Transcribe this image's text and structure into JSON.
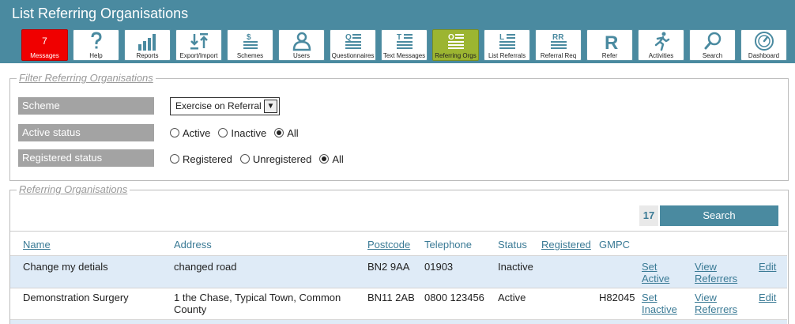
{
  "title": "List Referring Organisations",
  "toolbar": [
    {
      "label": "Messages",
      "icon": "messages-icon",
      "count": "7",
      "state": "alert"
    },
    {
      "label": "Help",
      "icon": "help-icon"
    },
    {
      "label": "Reports",
      "icon": "reports-icon"
    },
    {
      "label": "Export/Import",
      "icon": "export-import-icon"
    },
    {
      "label": "Schemes",
      "icon": "schemes-icon"
    },
    {
      "label": "Users",
      "icon": "users-icon"
    },
    {
      "label": "Questionnaires",
      "icon": "questionnaires-icon"
    },
    {
      "label": "Text Messages",
      "icon": "text-messages-icon"
    },
    {
      "label": "Referring Orgs",
      "icon": "referring-orgs-icon",
      "state": "active"
    },
    {
      "label": "List Referrals",
      "icon": "list-referrals-icon"
    },
    {
      "label": "Referral Req",
      "icon": "referral-req-icon"
    },
    {
      "label": "Refer",
      "icon": "refer-icon"
    },
    {
      "label": "Activities",
      "icon": "activities-icon"
    },
    {
      "label": "Search",
      "icon": "search-icon"
    },
    {
      "label": "Dashboard",
      "icon": "dashboard-icon"
    }
  ],
  "filter": {
    "legend": "Filter Referring Organisations",
    "scheme_label": "Scheme",
    "scheme_value": "Exercise on Referral",
    "active_label": "Active status",
    "active_options": [
      "Active",
      "Inactive",
      "All"
    ],
    "active_selected": "All",
    "registered_label": "Registered status",
    "registered_options": [
      "Registered",
      "Unregistered",
      "All"
    ],
    "registered_selected": "All"
  },
  "results": {
    "legend": "Referring Organisations",
    "count": "17",
    "search_label": "Search",
    "columns": [
      "Name",
      "Address",
      "Postcode",
      "Telephone",
      "Status",
      "Registered",
      "GMPC"
    ],
    "rows": [
      {
        "name": "Change my detials",
        "address": "changed road",
        "postcode": "BN2 9AA",
        "telephone": "01903",
        "status": "Inactive",
        "registered": "",
        "gmpc": "",
        "action1": "Set Active",
        "action2": "View Referrers",
        "action3": "Edit"
      },
      {
        "name": "Demonstration Surgery",
        "address": "1 the Chase, Typical Town, Common County",
        "postcode": "BN11 2AB",
        "telephone": "0800 123456",
        "status": "Active",
        "registered": "",
        "gmpc": "H82045",
        "action1": "Set Inactive",
        "action2": "View Referrers",
        "action3": "Edit"
      }
    ]
  },
  "colors": {
    "header": "#4a8aa0",
    "alert": "#f00000",
    "active_tab": "#9cb531",
    "link": "#3a7a95",
    "row_alt": "#dfebf7"
  }
}
